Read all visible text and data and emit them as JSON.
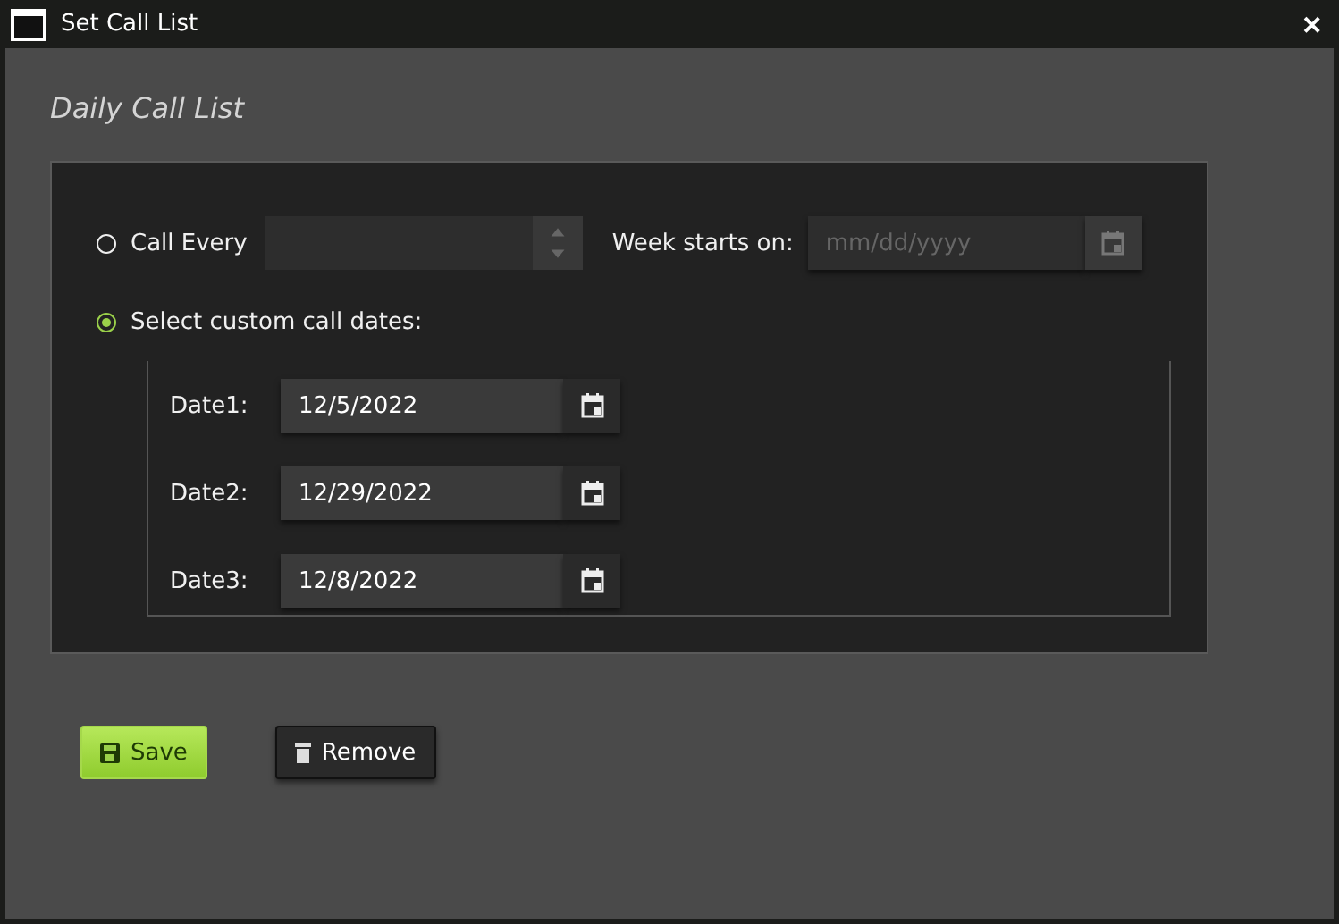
{
  "window": {
    "title": "Set Call List",
    "close": "✕"
  },
  "heading": "Daily Call List",
  "options": [
    {
      "label": "Call Every",
      "selected": false
    },
    {
      "label": "Select custom call dates:",
      "selected": true
    }
  ],
  "week_starts": {
    "label": "Week starts on:",
    "placeholder": "mm/dd/yyyy"
  },
  "dates": [
    {
      "label": "Date1:",
      "value": "12/5/2022"
    },
    {
      "label": "Date2:",
      "value": "12/29/2022"
    },
    {
      "label": "Date3:",
      "value": "12/8/2022"
    }
  ],
  "buttons": [
    {
      "label": "Save",
      "kind": "primary"
    },
    {
      "label": "Remove",
      "kind": "secondary"
    }
  ]
}
